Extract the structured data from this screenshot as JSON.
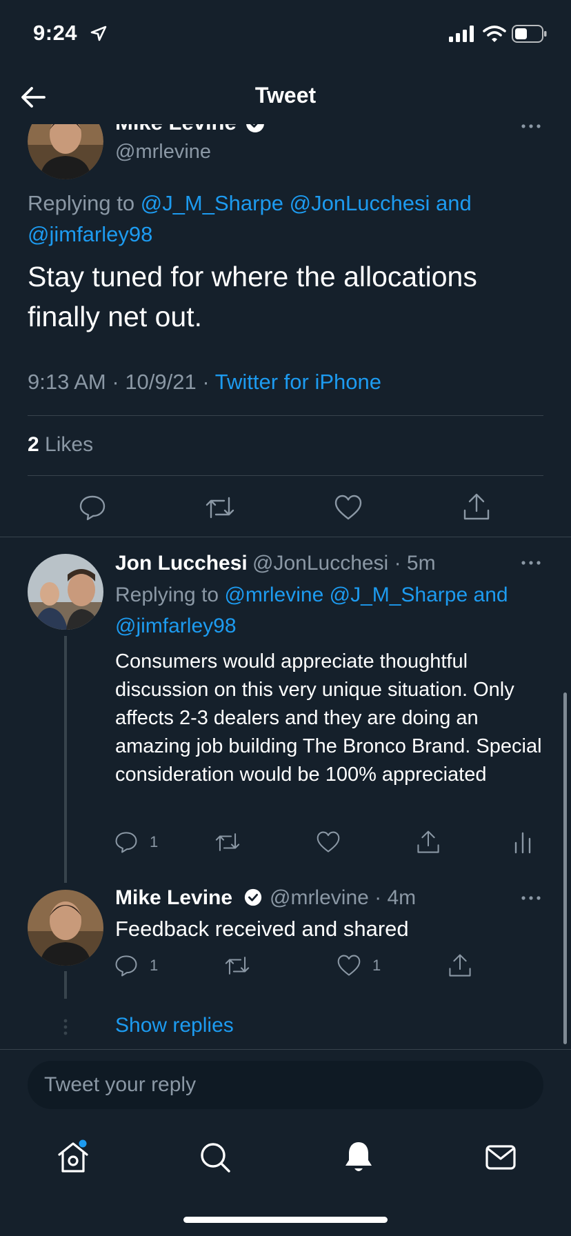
{
  "status_bar": {
    "time": "9:24"
  },
  "header": {
    "title": "Tweet"
  },
  "main_tweet": {
    "author_name": "Mike Levine",
    "handle": "@mrlevine",
    "replying_prefix": "Replying to",
    "replying_to_1": "@J_M_Sharpe",
    "replying_to_2": "@JonLucchesi",
    "replying_and": "and",
    "replying_to_3": "@jimfarley98",
    "text": "Stay tuned for where the allocations finally net out.",
    "time": "9:13 AM",
    "date": "10/9/21",
    "source": "Twitter for iPhone",
    "likes_count": "2",
    "likes_label": "Likes"
  },
  "replies": [
    {
      "author_name": "Jon Lucchesi",
      "handle": "@JonLucchesi",
      "age": "5m",
      "replying_prefix": "Replying to",
      "replying_to_1": "@mrlevine",
      "replying_to_2": "@J_M_Sharpe",
      "replying_and": "and",
      "replying_to_3": "@jimfarley98",
      "text": "Consumers would appreciate thoughtful discussion on this very unique situation. Only affects 2-3 dealers and they are doing an amazing job building The Bronco Brand. Special consideration would be 100% appreciated",
      "reply_count": "1"
    },
    {
      "author_name": "Mike Levine",
      "handle": "@mrlevine",
      "age": "4m",
      "text": "Feedback received and shared",
      "reply_count": "1",
      "like_count": "1"
    }
  ],
  "show_replies_label": "Show replies",
  "composer": {
    "placeholder": "Tweet your reply"
  },
  "tab_bar": [
    "home-icon",
    "search-icon",
    "notifications-icon",
    "messages-icon"
  ],
  "colors": {
    "background": "#15202b",
    "accent": "#1d9bf0",
    "muted": "#8b98a5",
    "divider": "#38444d"
  }
}
